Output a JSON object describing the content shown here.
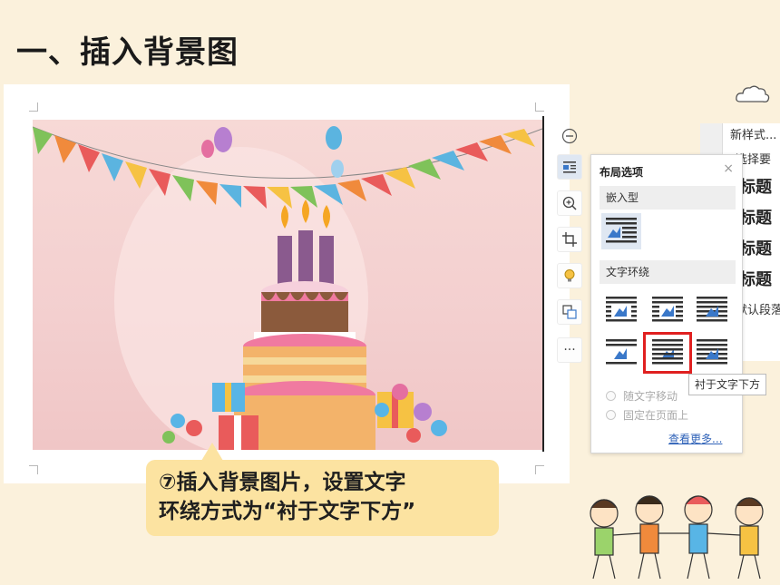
{
  "slide": {
    "title": "一、插入背景图"
  },
  "side_toolbar": {
    "buttons": [
      {
        "icon": "collapse-icon"
      },
      {
        "icon": "layout-options-icon"
      },
      {
        "icon": "zoom-in-icon"
      },
      {
        "icon": "crop-icon"
      },
      {
        "icon": "lightbulb-icon"
      },
      {
        "icon": "replace-image-icon"
      },
      {
        "icon": "more-icon",
        "label": "···"
      }
    ]
  },
  "styles_panel": {
    "new_style": "新样式...",
    "select_label": "选择要",
    "headings": [
      "标题",
      "标题",
      "标题",
      "标题"
    ],
    "default_paragraph": "默认段落"
  },
  "layout_panel": {
    "title": "布局选项",
    "close": "×",
    "section_inline": "嵌入型",
    "section_wrap": "文字环绕",
    "radio_move_with_text": "随文字移动",
    "radio_fix_on_page": "固定在页面上",
    "see_more": "查看更多..."
  },
  "tooltip": "衬于文字下方",
  "callout": {
    "line1": "⑦插入背景图片，设置文字",
    "line2": "环绕方式为“衬于文字下方”"
  },
  "colors": {
    "background": "#fbf1dc",
    "callout": "#fce3a1",
    "highlight": "#e02020",
    "icon_blue": "#3a78c9"
  }
}
